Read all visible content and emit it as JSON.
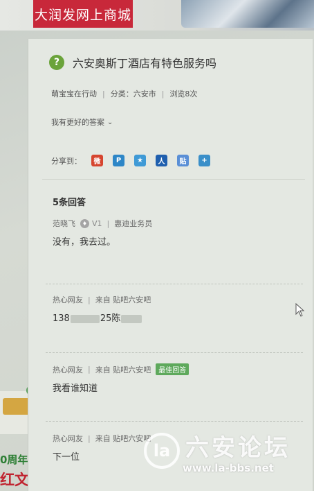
{
  "banner": {
    "ad_text": "大润发网上商城"
  },
  "question": {
    "title": "六安奥斯丁酒店有特色服务吗",
    "asker": "萌宝宝在行动",
    "category": "分类：六安市",
    "views": "浏览8次",
    "better_answer": "我有更好的答案"
  },
  "share": {
    "label": "分享到：",
    "icons": [
      {
        "name": "weibo-icon",
        "color": "#d6452f",
        "glyph": "微"
      },
      {
        "name": "qzone-icon",
        "color": "#2d86c7",
        "glyph": "P"
      },
      {
        "name": "tencent-weibo-icon",
        "color": "#3f9ad6",
        "glyph": "★"
      },
      {
        "name": "renren-icon",
        "color": "#1f5fae",
        "glyph": "人"
      },
      {
        "name": "kaixin-icon",
        "color": "#5a8fd6",
        "glyph": "贴"
      },
      {
        "name": "more-icon",
        "color": "#3a8fc9",
        "glyph": "+"
      }
    ]
  },
  "answers": {
    "count_label": "5条回答",
    "items": [
      {
        "user": "范晓飞",
        "level": "V1",
        "role": "惠迪业务员",
        "body": "没有，我去过。"
      },
      {
        "user": "热心网友",
        "source": "来自 贴吧六安吧",
        "body_prefix": "138",
        "body_mid": "25陈"
      },
      {
        "user": "热心网友",
        "source": "来自 贴吧六安吧",
        "tag": "最佳回答",
        "body": "我看谁知道"
      },
      {
        "user": "热心网友",
        "source": "来自 贴吧六安吧",
        "body": "下一位"
      }
    ]
  },
  "side_ad": {
    "anniversary": "0周年",
    "promo": "红文"
  },
  "watermark": {
    "name": "六安论坛",
    "url": "www.la-bbs.net",
    "logo": "la"
  },
  "colors": {
    "accent_green": "#6aa33a",
    "tag_green": "#5ea95c",
    "ad_red": "#c8283a"
  }
}
